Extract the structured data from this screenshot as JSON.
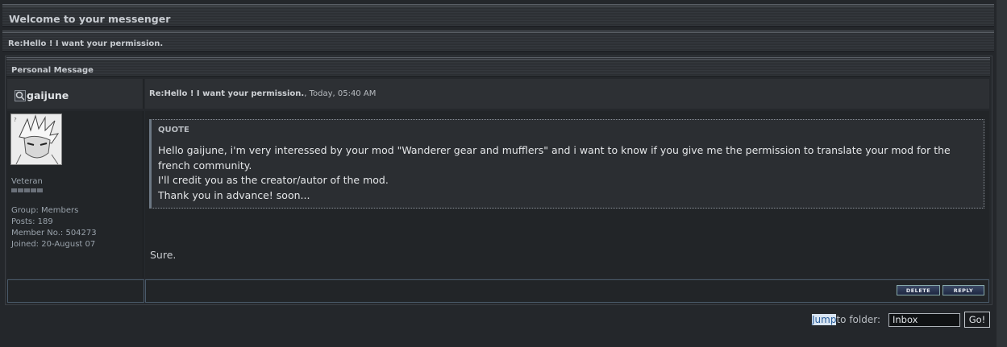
{
  "header": {
    "title": "Welcome to your messenger"
  },
  "subject_bar": {
    "title": "Re:Hello ! I want your permission."
  },
  "section": {
    "title": "Personal Message"
  },
  "author": {
    "username": "gaijune",
    "rank": "Veteran",
    "group": "Group: Members",
    "posts": "Posts: 189",
    "member_no": "Member No.: 504273",
    "joined": "Joined: 20-August 07"
  },
  "message": {
    "title": "Re:Hello ! I want your permission.",
    "meta": ", Today, 05:40 AM",
    "quote_label": "QUOTE",
    "quote_lines": [
      "Hello gaijune, i'm very interessed by your mod \"Wanderer gear and mufflers\" and i want to know if you give me the permission to translate your mod for the",
      "french community.",
      "I'll credit you as the creator/autor of the mod.",
      "Thank you in advance! soon..."
    ],
    "reply": "Sure."
  },
  "actions": {
    "delete": "DELETE",
    "reply": "REPLY"
  },
  "jump": {
    "highlight": "Jump",
    "label": " to folder:",
    "folder": "Inbox",
    "go": "Go!"
  },
  "icons": {
    "user": "profile-icon"
  }
}
